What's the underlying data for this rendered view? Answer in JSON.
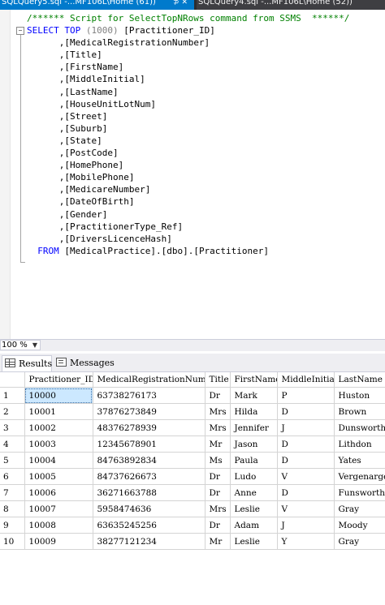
{
  "tabs": [
    {
      "label": "SQLQuery5.sql -...MF106L\\Home (61))",
      "pin": "⊅ ✕"
    },
    {
      "label": "SQLQuery4.sql -...MF106L\\Home (52))"
    }
  ],
  "editor": {
    "comment": "/****** Script for SelectTopNRows command from SSMS  ******/",
    "select_kw": "SELECT",
    "top_kw": "TOP",
    "top_value": "(1000)",
    "first_column": "[Practitioner_ID]",
    "columns": [
      ",[MedicalRegistrationNumber]",
      ",[Title]",
      ",[FirstName]",
      ",[MiddleInitial]",
      ",[LastName]",
      ",[HouseUnitLotNum]",
      ",[Street]",
      ",[Suburb]",
      ",[State]",
      ",[PostCode]",
      ",[HomePhone]",
      ",[MobilePhone]",
      ",[MedicareNumber]",
      ",[DateOfBirth]",
      ",[Gender]",
      ",[PractitionerType_Ref]",
      ",[DriversLicenceHash]"
    ],
    "from_kw": "FROM",
    "from_table": "[MedicalPractice].[dbo].[Practitioner]",
    "collapse_symbol": "⊟"
  },
  "zoom": {
    "value": "100 %"
  },
  "results_tabs": {
    "results": "Results",
    "messages": "Messages"
  },
  "grid": {
    "columns": [
      "Practitioner_ID",
      "MedicalRegistrationNumber",
      "Title",
      "FirstName",
      "MiddleInitial",
      "LastName"
    ],
    "rows": [
      [
        "1",
        "10000",
        "63738276173",
        "Dr",
        "Mark",
        "P",
        "Huston"
      ],
      [
        "2",
        "10001",
        "37876273849",
        "Mrs",
        "Hilda",
        "D",
        "Brown"
      ],
      [
        "3",
        "10002",
        "48376278939",
        "Mrs",
        "Jennifer",
        "J",
        "Dunsworth"
      ],
      [
        "4",
        "10003",
        "12345678901",
        "Mr",
        "Jason",
        "D",
        "Lithdon"
      ],
      [
        "5",
        "10004",
        "84763892834",
        "Ms",
        "Paula",
        "D",
        "Yates"
      ],
      [
        "6",
        "10005",
        "84737626673",
        "Dr",
        "Ludo",
        "V",
        "Vergenarger"
      ],
      [
        "7",
        "10006",
        "36271663788",
        "Dr",
        "Anne",
        "D",
        "Funsworth"
      ],
      [
        "8",
        "10007",
        "5958474636",
        "Mrs",
        "Leslie",
        "V",
        "Gray"
      ],
      [
        "9",
        "10008",
        "63635245256",
        "Dr",
        "Adam",
        "J",
        "Moody"
      ],
      [
        "10",
        "10009",
        "38277121234",
        "Mr",
        "Leslie",
        "Y",
        "Gray"
      ]
    ]
  },
  "colors": {
    "tab_active": "#007acc",
    "tab_inactive": "#3e3e42",
    "keyword": "#0000ff",
    "comment": "#008000",
    "selection": "#cce8ff"
  }
}
